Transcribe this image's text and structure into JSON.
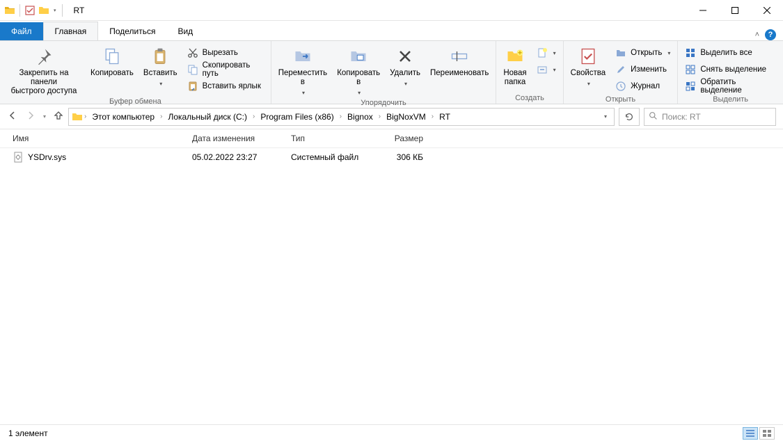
{
  "window": {
    "title": "RT"
  },
  "tabs": {
    "file": "Файл",
    "home": "Главная",
    "share": "Поделиться",
    "view": "Вид"
  },
  "ribbon": {
    "clipboard": {
      "pin": "Закрепить на панели\nбыстрого доступа",
      "copy": "Копировать",
      "paste": "Вставить",
      "cut": "Вырезать",
      "copy_path": "Скопировать путь",
      "paste_shortcut": "Вставить ярлык",
      "group": "Буфер обмена"
    },
    "organize": {
      "move_to": "Переместить\nв",
      "copy_to": "Копировать\nв",
      "delete": "Удалить",
      "rename": "Переименовать",
      "group": "Упорядочить"
    },
    "new": {
      "new_folder": "Новая\nпапка",
      "group": "Создать"
    },
    "open": {
      "properties": "Свойства",
      "open": "Открыть",
      "edit": "Изменить",
      "history": "Журнал",
      "group": "Открыть"
    },
    "select": {
      "select_all": "Выделить все",
      "select_none": "Снять выделение",
      "invert": "Обратить выделение",
      "group": "Выделить"
    }
  },
  "breadcrumbs": [
    "Этот компьютер",
    "Локальный диск (C:)",
    "Program Files (x86)",
    "Bignox",
    "BigNoxVM",
    "RT"
  ],
  "search": {
    "placeholder": "Поиск: RT"
  },
  "columns": {
    "name": "Имя",
    "date": "Дата изменения",
    "type": "Тип",
    "size": "Размер"
  },
  "files": [
    {
      "name": "YSDrv.sys",
      "date": "05.02.2022 23:27",
      "type": "Системный файл",
      "size": "306 КБ"
    }
  ],
  "status": {
    "count": "1 элемент"
  }
}
